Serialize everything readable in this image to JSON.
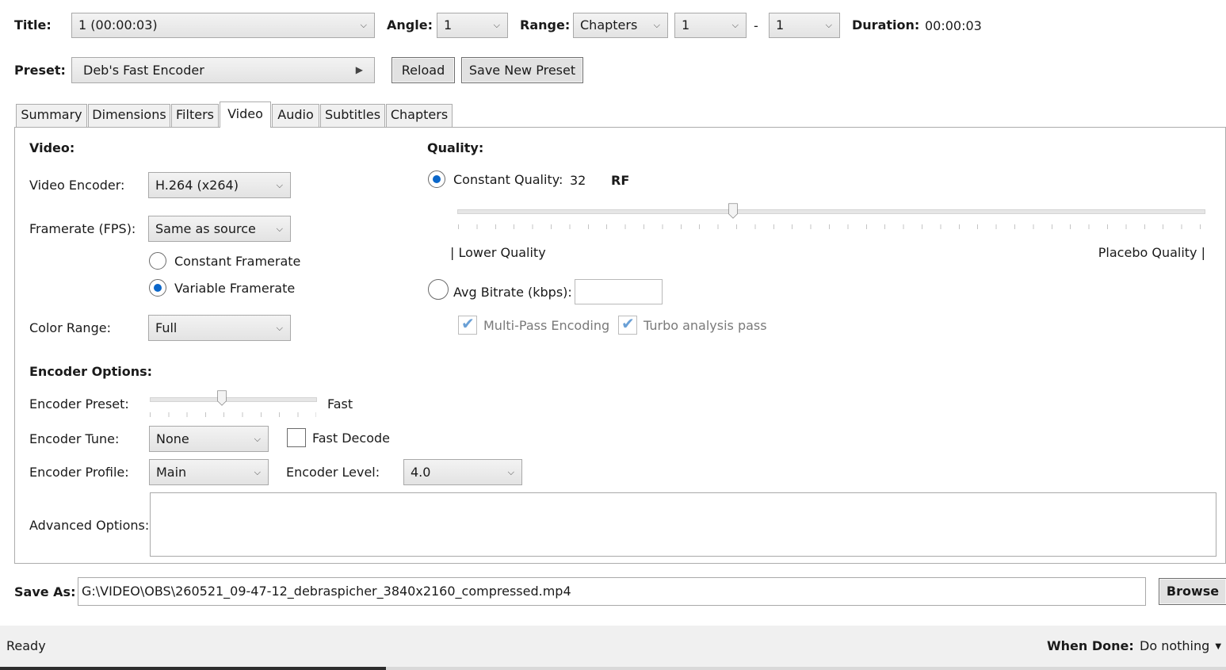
{
  "header": {
    "title_label": "Title:",
    "title_value": "1  (00:00:03)",
    "angle_label": "Angle:",
    "angle_value": "1",
    "range_label": "Range:",
    "range_type": "Chapters",
    "range_start": "1",
    "range_sep": "-",
    "range_end": "1",
    "duration_label": "Duration:",
    "duration_value": "00:00:03"
  },
  "preset": {
    "label": "Preset:",
    "value": "Deb's Fast Encoder",
    "reload_label": "Reload",
    "save_new_label": "Save New Preset"
  },
  "tabs": [
    {
      "label": "Summary"
    },
    {
      "label": "Dimensions"
    },
    {
      "label": "Filters"
    },
    {
      "label": "Video",
      "active": true
    },
    {
      "label": "Audio"
    },
    {
      "label": "Subtitles"
    },
    {
      "label": "Chapters"
    }
  ],
  "video": {
    "section_title": "Video:",
    "encoder_label": "Video Encoder:",
    "encoder_value": "H.264 (x264)",
    "framerate_label": "Framerate (FPS):",
    "framerate_value": "Same as source",
    "constant_framerate_label": "Constant Framerate",
    "variable_framerate_label": "Variable Framerate",
    "variable_framerate_selected": true,
    "color_range_label": "Color Range:",
    "color_range_value": "Full"
  },
  "quality": {
    "section_title": "Quality:",
    "constant_quality_label": "Constant Quality:",
    "constant_quality_value": "32",
    "rf_label": "RF",
    "constant_quality_selected": true,
    "slider_fraction": 0.37,
    "lower_label": "| Lower Quality",
    "placebo_label": "Placebo Quality |",
    "avg_bitrate_label": "Avg Bitrate (kbps):",
    "avg_bitrate_value": "",
    "multipass_label": "Multi-Pass Encoding",
    "multipass_checked": true,
    "turbo_label": "Turbo analysis pass",
    "turbo_checked": true
  },
  "encoder_options": {
    "section_title": "Encoder Options:",
    "preset_label": "Encoder Preset:",
    "preset_value": "Fast",
    "preset_slider_fraction": 0.44,
    "tune_label": "Encoder Tune:",
    "tune_value": "None",
    "fast_decode_label": "Fast Decode",
    "fast_decode_checked": false,
    "profile_label": "Encoder Profile:",
    "profile_value": "Main",
    "level_label": "Encoder Level:",
    "level_value": "4.0",
    "advanced_label": "Advanced Options:",
    "advanced_value": ""
  },
  "save_as": {
    "label": "Save As:",
    "path": "G:\\VIDEO\\OBS\\260521_09-47-12_debraspicher_3840x2160_compressed.mp4",
    "browse_label": "Browse"
  },
  "status_bar": {
    "status": "Ready",
    "when_done_label": "When Done:",
    "when_done_value": "Do nothing"
  },
  "colors": {
    "accent": "#0a66c9",
    "status_bar_bg": "#f0f0f0"
  }
}
